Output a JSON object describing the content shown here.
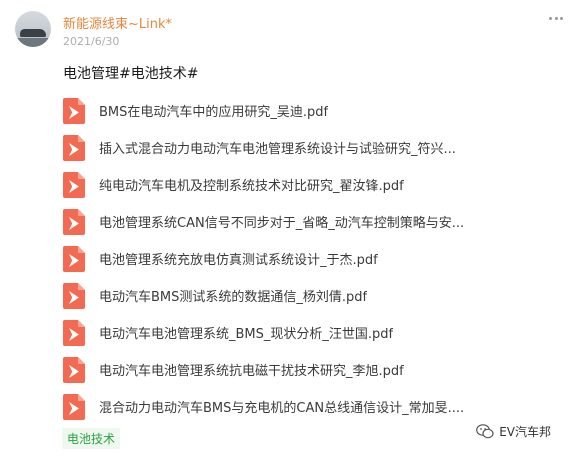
{
  "post": {
    "author": "新能源线束~Link*",
    "date": "2021/6/30",
    "title": "电池管理#电池技术#"
  },
  "files": [
    {
      "name": "BMS在电动汽车中的应用研究_吴迪.pdf",
      "icon": "pdf-file-icon"
    },
    {
      "name": "插入式混合动力电动汽车电池管理系统设计与试验研究_符兴...",
      "icon": "pdf-file-icon"
    },
    {
      "name": "纯电动汽车电机及控制系统技术对比研究_翟汝锋.pdf",
      "icon": "pdf-file-icon"
    },
    {
      "name": "电池管理系统CAN信号不同步对于_省略_动汽车控制策略与安...",
      "icon": "pdf-file-icon"
    },
    {
      "name": "电池管理系统充放电仿真测试系统设计_于杰.pdf",
      "icon": "pdf-file-icon"
    },
    {
      "name": "电动汽车BMS测试系统的数据通信_杨刘倩.pdf",
      "icon": "pdf-file-icon"
    },
    {
      "name": "电动汽车电池管理系统_BMS_现状分析_汪世国.pdf",
      "icon": "pdf-file-icon"
    },
    {
      "name": "电动汽车电池管理系统抗电磁干扰技术研究_李旭.pdf",
      "icon": "pdf-file-icon"
    },
    {
      "name": "混合动力电动汽车BMS与充电机的CAN总线通信设计_常加旻....",
      "icon": "pdf-file-icon"
    }
  ],
  "tag": "电池技术",
  "brand": "EV汽车邦",
  "colors": {
    "author": "#e8873a",
    "pdf_icon": "#f26a52",
    "tag_text": "#2ba245",
    "tag_bg": "#eef8ef"
  }
}
